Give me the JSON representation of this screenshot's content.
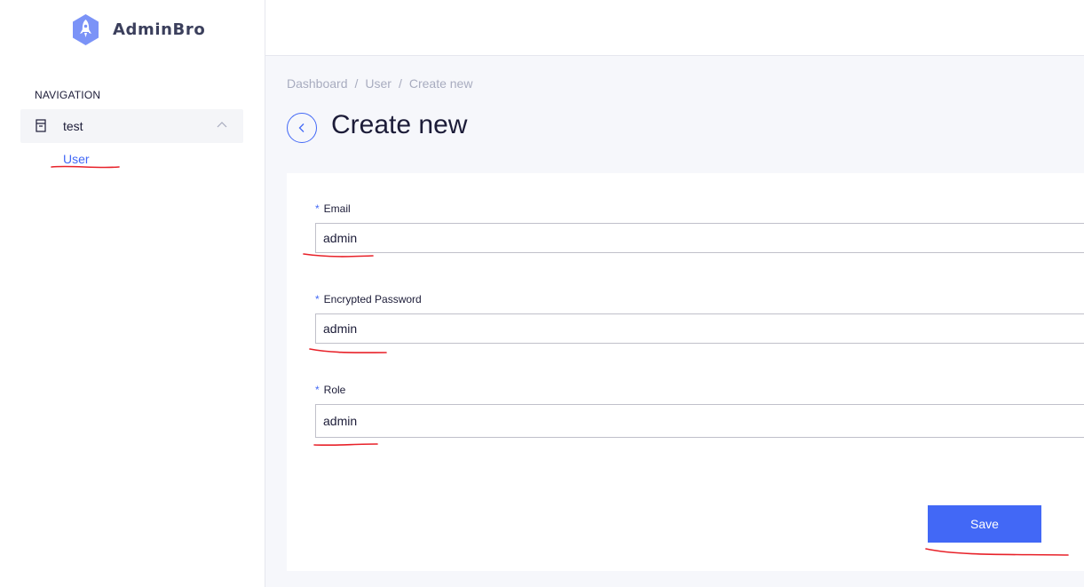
{
  "app": {
    "brand": "AdminBro"
  },
  "sidebar": {
    "heading": "NAVIGATION",
    "group": {
      "label": "test",
      "icon": "folder-icon"
    },
    "items": [
      {
        "label": "User"
      }
    ]
  },
  "breadcrumb": {
    "items": [
      "Dashboard",
      "User",
      "Create new"
    ],
    "separator": "/"
  },
  "page": {
    "title": "Create new"
  },
  "form": {
    "required_marker": "*",
    "fields": [
      {
        "label": "Email",
        "value": "admin"
      },
      {
        "label": "Encrypted Password",
        "value": "admin"
      },
      {
        "label": "Role",
        "value": "admin"
      }
    ],
    "save_label": "Save"
  },
  "colors": {
    "accent": "#4268f6",
    "annotation": "#e8222a"
  }
}
